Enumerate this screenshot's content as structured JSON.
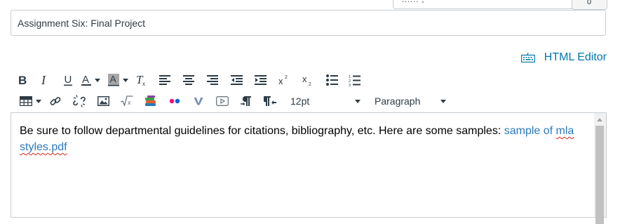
{
  "top": {
    "fragment": "...... ,",
    "button_label": "0"
  },
  "assignment": {
    "title": "Assignment Six: Final Project"
  },
  "html_editor": {
    "label": "HTML Editor",
    "icon": "keyboard-icon"
  },
  "toolbar": {
    "row1": [
      {
        "name": "bold-button",
        "icon": "bold-icon"
      },
      {
        "name": "italic-button",
        "icon": "italic-icon"
      },
      {
        "name": "underline-button",
        "icon": "underline-icon"
      },
      {
        "name": "text-color-button",
        "icon": "text-color-icon"
      },
      {
        "name": "background-color-button",
        "icon": "background-color-icon"
      },
      {
        "name": "clear-formatting-button",
        "icon": "clear-formatting-icon"
      },
      {
        "name": "align-left-button",
        "icon": "align-left-icon"
      },
      {
        "name": "align-center-button",
        "icon": "align-center-icon"
      },
      {
        "name": "align-right-button",
        "icon": "align-right-icon"
      },
      {
        "name": "outdent-button",
        "icon": "outdent-icon"
      },
      {
        "name": "indent-button",
        "icon": "indent-icon"
      },
      {
        "name": "superscript-button",
        "icon": "superscript-icon"
      },
      {
        "name": "subscript-button",
        "icon": "subscript-icon"
      },
      {
        "name": "bullet-list-button",
        "icon": "bullet-list-icon"
      },
      {
        "name": "numbered-list-button",
        "icon": "numbered-list-icon"
      }
    ],
    "row2": [
      {
        "name": "table-button",
        "icon": "table-icon"
      },
      {
        "name": "link-button",
        "icon": "link-icon"
      },
      {
        "name": "unlink-button",
        "icon": "unlink-icon"
      },
      {
        "name": "image-button",
        "icon": "image-icon"
      },
      {
        "name": "math-equation-button",
        "icon": "square-root-icon"
      },
      {
        "name": "apps-button",
        "icon": "books-icon"
      },
      {
        "name": "flickr-button",
        "icon": "flickr-icon"
      },
      {
        "name": "vimeo-button",
        "icon": "v-icon"
      },
      {
        "name": "media-button",
        "icon": "media-icon"
      },
      {
        "name": "ltr-button",
        "icon": "ltr-paragraph-icon"
      },
      {
        "name": "rtl-button",
        "icon": "rtl-paragraph-icon"
      }
    ],
    "font_size": "12pt",
    "block_format": "Paragraph"
  },
  "editor": {
    "text": "Be sure to follow departmental guidelines for citations, bibliography, etc. Here are some samples: ",
    "link_parts": [
      "sample of ",
      "mla",
      " ",
      "styles.pdf"
    ]
  },
  "colors": {
    "link": "#0077ad",
    "editor_link": "#2b7abc",
    "spellcheck": "#e0241b",
    "border": "#c7cdd1"
  }
}
